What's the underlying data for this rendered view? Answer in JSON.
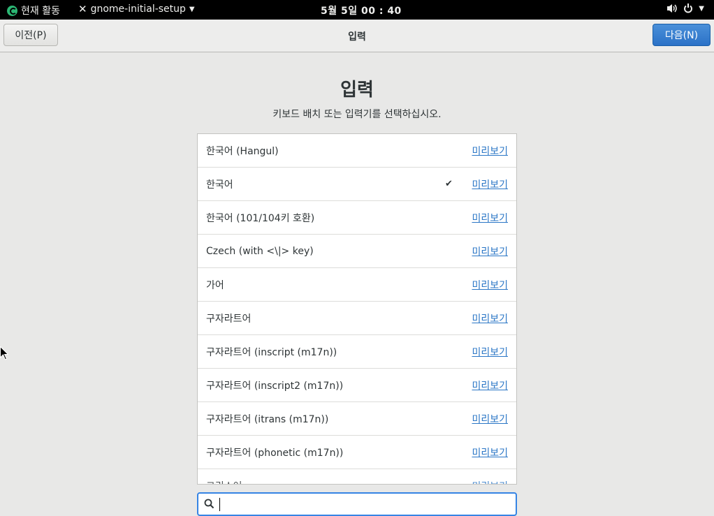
{
  "topbar": {
    "activities_label": "현재 활동",
    "app_name": "gnome-initial-setup",
    "clock": "5월 5일  00 : 40"
  },
  "header": {
    "prev_label": "이전(P)",
    "title": "입력",
    "next_label": "다음(N)"
  },
  "main": {
    "title": "입력",
    "description": "키보드 배치 또는 입력기를 선택하십시오.",
    "preview_label": "미리보기",
    "rows": [
      {
        "name": "한국어 (Hangul)",
        "selected": false
      },
      {
        "name": "한국어",
        "selected": true
      },
      {
        "name": "한국어 (101/104키 호환)",
        "selected": false
      },
      {
        "name": "Czech (with <\\|> key)",
        "selected": false
      },
      {
        "name": "가어",
        "selected": false
      },
      {
        "name": "구자라트어",
        "selected": false
      },
      {
        "name": "구자라트어 (inscript (m17n))",
        "selected": false
      },
      {
        "name": "구자라트어 (inscript2 (m17n))",
        "selected": false
      },
      {
        "name": "구자라트어 (itrans (m17n))",
        "selected": false
      },
      {
        "name": "구자라트어 (phonetic (m17n))",
        "selected": false
      },
      {
        "name": "그리스어",
        "selected": false
      }
    ],
    "check_mark": "✔"
  },
  "search": {
    "value": "",
    "placeholder": ""
  },
  "colors": {
    "accent": "#3584e4",
    "link": "#2a76c6",
    "topbar_bg": "#000000"
  }
}
